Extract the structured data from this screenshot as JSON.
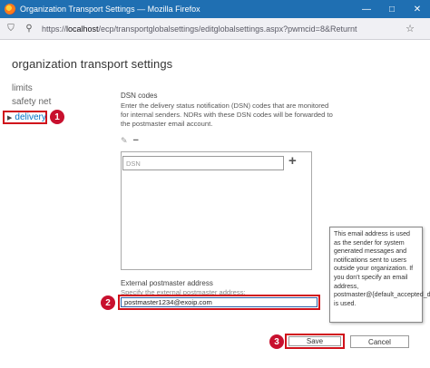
{
  "window": {
    "title": "Organization Transport Settings — Mozilla Firefox",
    "minimize_glyph": "—",
    "maximize_glyph": "□",
    "close_glyph": "✕"
  },
  "browser": {
    "url_prefix": "https://",
    "url_host": "localhost",
    "url_rest": "/ecp/transportglobalsettings/editglobalsettings.aspx?pwmcid=8&Returnt",
    "shield_glyph": "⛉",
    "settings_glyph": "⚲",
    "star_glyph": "☆"
  },
  "page": {
    "title": "organization transport settings"
  },
  "nav": {
    "items": [
      {
        "label": "limits"
      },
      {
        "label": "safety net"
      },
      {
        "label": "delivery"
      }
    ],
    "selected_arrow": "▶"
  },
  "dsn": {
    "label": "DSN codes",
    "description": "Enter the delivery status notification (DSN) codes that are monitored for internal senders. NDRs with these DSN codes will be forwarded to the postmaster email account.",
    "edit_glyph": "✎",
    "remove_glyph": "−",
    "add_glyph": "+",
    "input_placeholder": "DSN"
  },
  "external": {
    "label": "External postmaster address",
    "sublabel": "Specify the external postmaster address:",
    "value": "postmaster1234@exoip.com"
  },
  "tooltip": {
    "text": "This email address is used as the sender for system generated messages and notifications sent to users outside your organization. If you don't specify an email address, postmaster@{default_accepted_domain} is used."
  },
  "buttons": {
    "save": "Save",
    "cancel": "Cancel"
  },
  "badges": {
    "one": "1",
    "two": "2",
    "three": "3"
  },
  "colors": {
    "titlebar": "#1f6fb2",
    "highlight": "#d0121b",
    "badge": "#c8102e",
    "link": "#0072c6"
  }
}
